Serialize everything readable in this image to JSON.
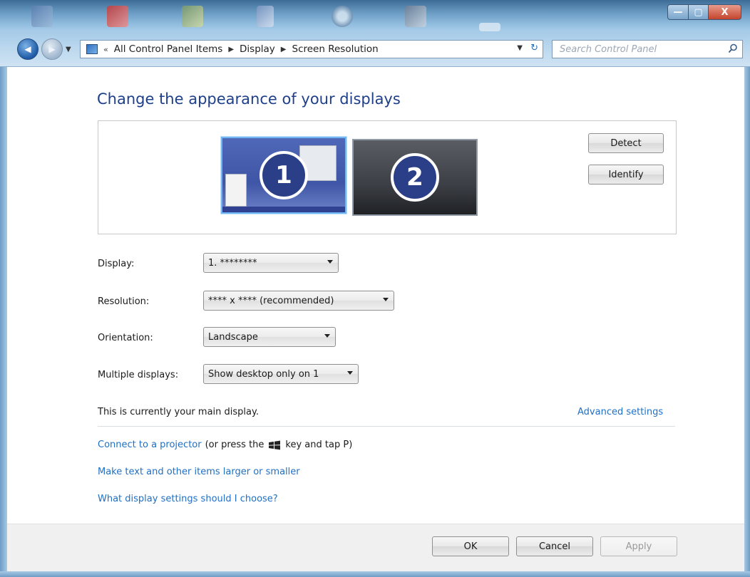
{
  "window": {
    "controls": {
      "minimize": "—",
      "maximize": "▢",
      "close": "X"
    }
  },
  "nav": {
    "back_glyph": "◀",
    "forward_glyph": "▶",
    "breadcrumb_prefix": "«",
    "breadcrumbs": [
      "All Control Panel Items",
      "Display",
      "Screen Resolution"
    ],
    "separator": "▶",
    "refresh_glyph": "↻",
    "search_placeholder": "Search Control Panel"
  },
  "main": {
    "title": "Change the appearance of your displays",
    "monitors": [
      {
        "number": "1",
        "selected": true
      },
      {
        "number": "2",
        "selected": false
      }
    ],
    "detect_label": "Detect",
    "identify_label": "Identify",
    "fields": {
      "display": {
        "label": "Display:",
        "value": "1. ********"
      },
      "resolution": {
        "label": "Resolution:",
        "value": "**** x **** (recommended)"
      },
      "orientation": {
        "label": "Orientation:",
        "value": "Landscape"
      },
      "multiple": {
        "label": "Multiple displays:",
        "value": "Show desktop only on 1"
      }
    },
    "main_display_note": "This is currently your main display.",
    "advanced_link": "Advanced settings",
    "projector": {
      "link": "Connect to a projector",
      "text_before_key": "(or press the",
      "text_after_key": "key and tap P)"
    },
    "text_size_link": "Make text and other items larger or smaller",
    "help_link": "What display settings should I choose?"
  },
  "footer": {
    "ok_label": "OK",
    "cancel_label": "Cancel",
    "apply_label": "Apply"
  },
  "colors": {
    "title_blue": "#1e3f8a",
    "link_blue": "#1f6fc4",
    "selected_monitor_border": "#6fb6f2"
  },
  "icons": [
    "back-icon",
    "forward-icon",
    "control-panel-icon",
    "refresh-icon",
    "search-icon",
    "windows-key-icon"
  ]
}
